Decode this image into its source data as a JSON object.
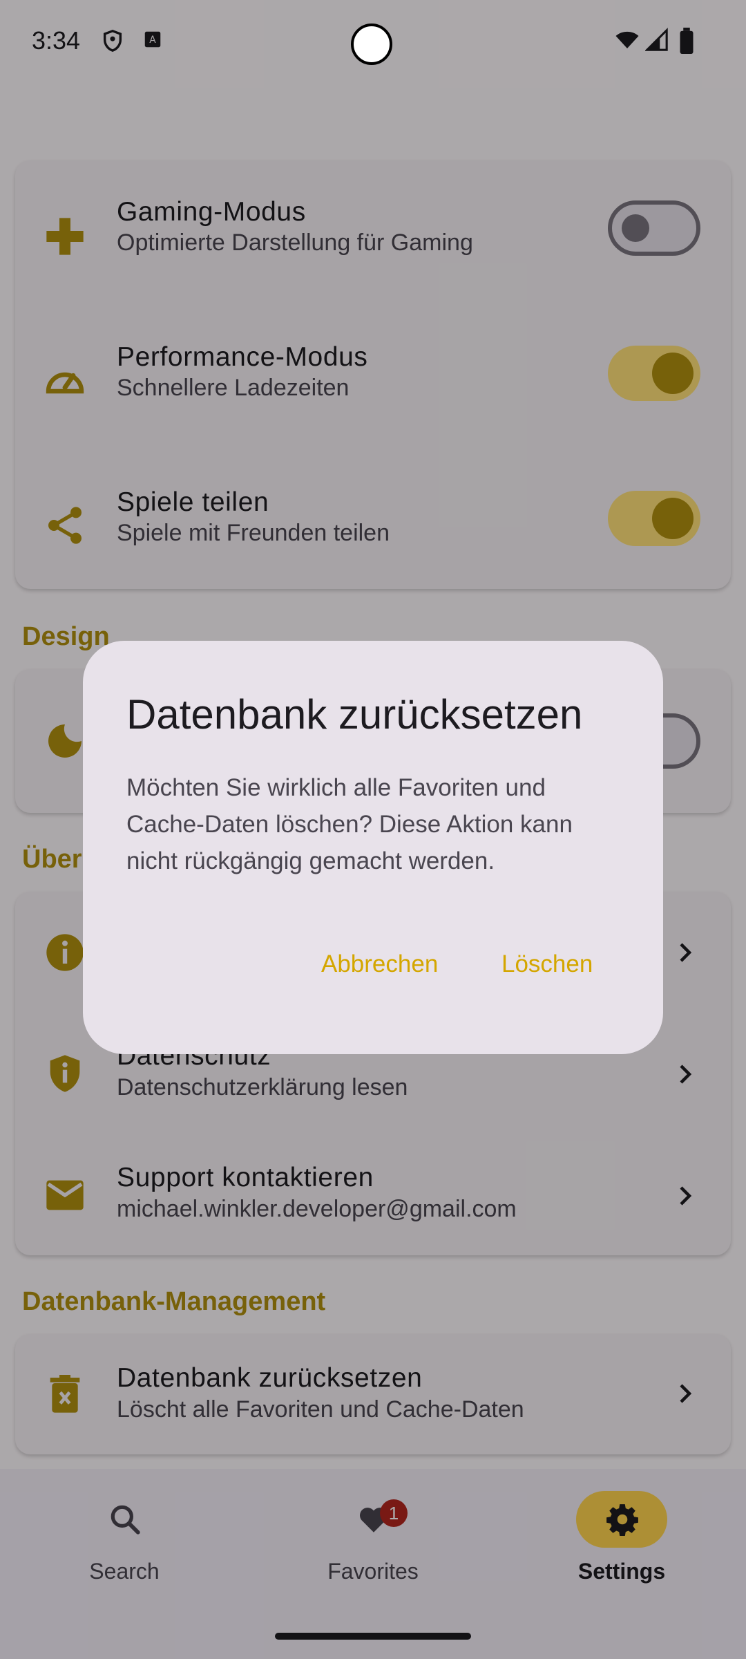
{
  "status_bar": {
    "time": "3:34"
  },
  "settings_card": {
    "rows": [
      {
        "title": "Gaming-Modus",
        "subtitle": "Optimierte Darstellung für Gaming",
        "icon": "gamepad-icon",
        "switch_on": false
      },
      {
        "title": "Performance-Modus",
        "subtitle": "Schnellere Ladezeiten",
        "icon": "speedometer-icon",
        "switch_on": true
      },
      {
        "title": "Spiele teilen",
        "subtitle": "Spiele mit Freunden teilen",
        "icon": "share-icon",
        "switch_on": true
      }
    ]
  },
  "design_section": {
    "title": "Design"
  },
  "about_section": {
    "title": "Über",
    "rows": [
      {
        "title": "",
        "subtitle": "",
        "icon": "info-icon"
      },
      {
        "title": "Datenschutz",
        "subtitle": "Datenschutzerklärung lesen",
        "icon": "privacy-shield-icon"
      },
      {
        "title": "Support kontaktieren",
        "subtitle": "michael.winkler.developer@gmail.com",
        "icon": "mail-icon"
      }
    ]
  },
  "db_section": {
    "title": "Datenbank-Management",
    "row": {
      "title": "Datenbank zurücksetzen",
      "subtitle": "Löscht alle Favoriten und Cache-Daten",
      "icon": "trash-icon"
    }
  },
  "bottom_nav": {
    "items": [
      {
        "label": "Search",
        "icon": "search-icon"
      },
      {
        "label": "Favorites",
        "icon": "heart-icon",
        "badge": "1"
      },
      {
        "label": "Settings",
        "icon": "gear-icon",
        "active": true
      }
    ]
  },
  "dialog": {
    "title": "Datenbank zurücksetzen",
    "body": "Möchten Sie wirklich alle Favoriten und Cache-Daten löschen? Diese Aktion kann nicht rückgängig gemacht werden.",
    "cancel_label": "Abbrechen",
    "confirm_label": "Löschen"
  },
  "colors": {
    "accent": "#b08f10",
    "switch_track_on": "#ffe07a",
    "dialog_button": "#d4a600",
    "badge": "#b3261e"
  }
}
